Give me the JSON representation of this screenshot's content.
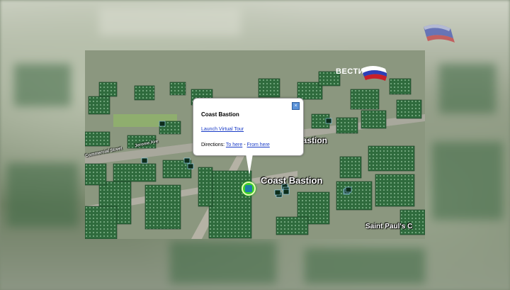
{
  "balloon": {
    "title": "Coast Bastion",
    "tour_link": "Launch Virtual Tour",
    "directions_label": "Directions:",
    "to_here": "To here",
    "separator": "-",
    "from_here": "From here",
    "close_icon": "close-icon"
  },
  "labels": {
    "main": "Coast Bastion",
    "top": "Bastion",
    "saint": "Saint Paul's C",
    "street_a": "Commercial Street",
    "street_b": "Jerome Ave"
  },
  "logo": {
    "text": "ВЕСТИ"
  },
  "colors": {
    "building": "#2f6b3d",
    "building_light": "#5a9267",
    "pin": "#3ccf2b",
    "link": "#1a3cc7"
  }
}
